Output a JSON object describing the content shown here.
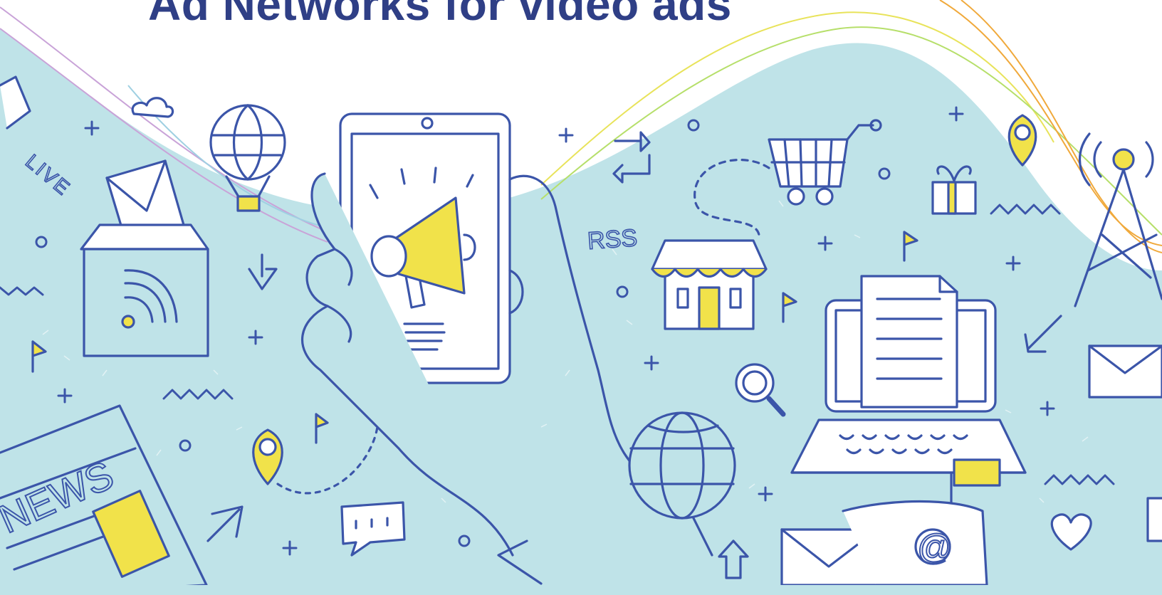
{
  "title": "Ad Networks  for video ads",
  "labels": {
    "live": "LIVE",
    "rss": "RSS",
    "news": "NEWS",
    "at_sign": "@"
  },
  "colors": {
    "ink": "#3b55a9",
    "title": "#2f3f86",
    "teal": "#bfe3e8",
    "yellow": "#f1e24a",
    "shadow": "#d9dce8",
    "orange_line": "#f0a93b",
    "purple_line": "#c9a3d8"
  },
  "icons": [
    "megaphone-icon",
    "smartphone-icon",
    "hand-icon",
    "hot-air-balloon-icon",
    "mailbox-icon",
    "shopping-cart-icon",
    "store-icon",
    "laptop-icon",
    "document-icon",
    "globe-icon",
    "magnifier-icon",
    "location-pin-icon",
    "gift-icon",
    "radio-tower-icon",
    "envelope-icon",
    "heart-icon",
    "speech-bubble-icon",
    "newspaper-icon",
    "flag-icon",
    "cloud-icon"
  ]
}
